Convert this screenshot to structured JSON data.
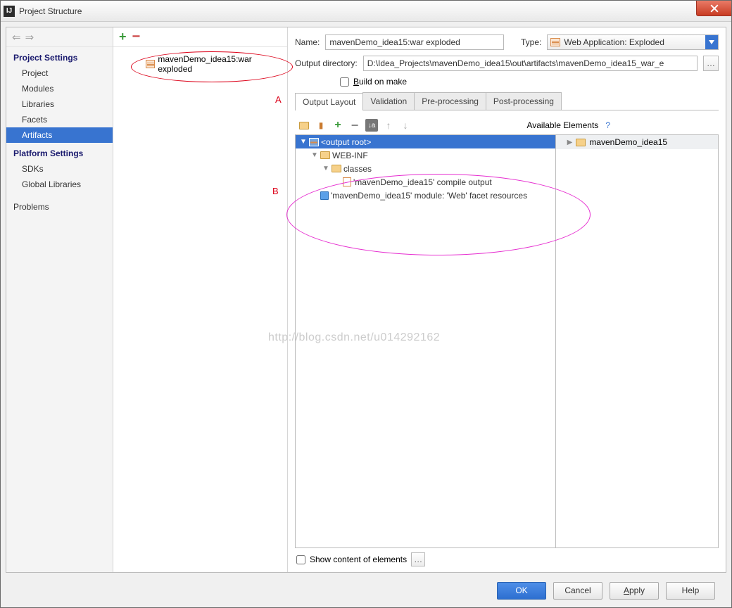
{
  "window": {
    "title": "Project Structure"
  },
  "sidebar": {
    "section1": "Project Settings",
    "items1": [
      "Project",
      "Modules",
      "Libraries",
      "Facets",
      "Artifacts"
    ],
    "section2": "Platform Settings",
    "items2": [
      "SDKs",
      "Global Libraries"
    ],
    "problems": "Problems"
  },
  "artifactList": {
    "item": "mavenDemo_idea15:war exploded"
  },
  "annotations": {
    "a": "A",
    "b": "B"
  },
  "form": {
    "nameLabel": "Name:",
    "nameValue": "mavenDemo_idea15:war exploded",
    "typeLabel": "Type:",
    "typeValue": "Web Application: Exploded",
    "outdirLabel": "Output directory:",
    "outdirValue": "D:\\Idea_Projects\\mavenDemo_idea15\\out\\artifacts\\mavenDemo_idea15_war_e",
    "buildOnMakePre": "B",
    "buildOnMakeU": "u",
    "buildOnMakePost": "ild on make"
  },
  "tabs": [
    "Output Layout",
    "Validation",
    "Pre-processing",
    "Post-processing"
  ],
  "availHeader": "Available Elements",
  "availItem": "mavenDemo_idea15",
  "tree": {
    "root": "<output root>",
    "webinf": "WEB-INF",
    "classes": "classes",
    "compile": "'mavenDemo_idea15' compile output",
    "facet": "'mavenDemo_idea15' module: 'Web' facet resources"
  },
  "showContent": "Show content of elements",
  "buttons": {
    "ok": "OK",
    "cancel": "Cancel",
    "apply": "Apply",
    "help": "Help"
  },
  "applyU": "A",
  "applyRest": "pply",
  "watermark": "http://blog.csdn.net/u014292162"
}
